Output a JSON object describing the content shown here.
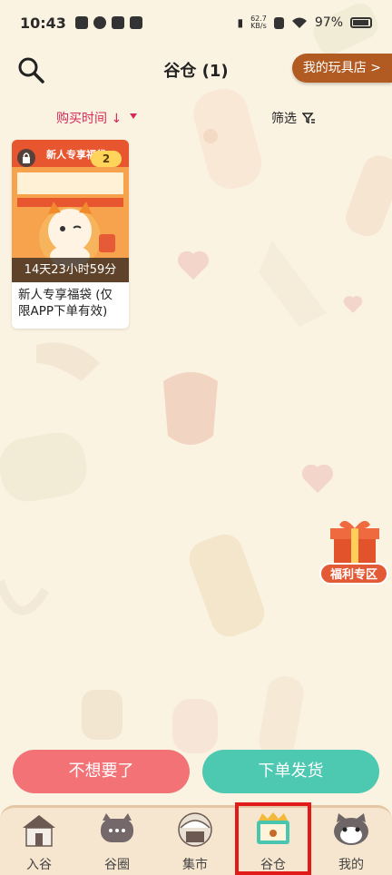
{
  "status_bar": {
    "time": "10:43",
    "net_speed_value": "62.7",
    "net_speed_unit": "KB/s",
    "battery": "97%"
  },
  "header": {
    "title": "谷仓 (1)",
    "shop_button": "我的玩具店 >"
  },
  "sort_bar": {
    "purchase_time": "购买时间 ↓",
    "filter": "筛选"
  },
  "items": [
    {
      "count_badge": "2",
      "countdown": "14天23小时59分",
      "title": "新人专享福袋 (仅限APP下单有效)",
      "image_banner": "新人专享福袋"
    }
  ],
  "welfare": {
    "label": "福利专区"
  },
  "actions": {
    "unwanted": "不想要了",
    "place_order": "下单发货"
  },
  "bottom_nav": {
    "items": [
      {
        "label": "入谷",
        "icon": "house-icon"
      },
      {
        "label": "谷圈",
        "icon": "chat-cat-icon"
      },
      {
        "label": "集市",
        "icon": "market-icon"
      },
      {
        "label": "谷仓",
        "icon": "barn-box-icon"
      },
      {
        "label": "我的",
        "icon": "cat-face-icon"
      }
    ],
    "active": "谷仓"
  },
  "colors": {
    "accent_sort": "#d6285a",
    "shop_button": "#b15b23",
    "btn_unwanted": "#f37276",
    "btn_order": "#4dc8b1",
    "background": "#fbf3e2"
  }
}
